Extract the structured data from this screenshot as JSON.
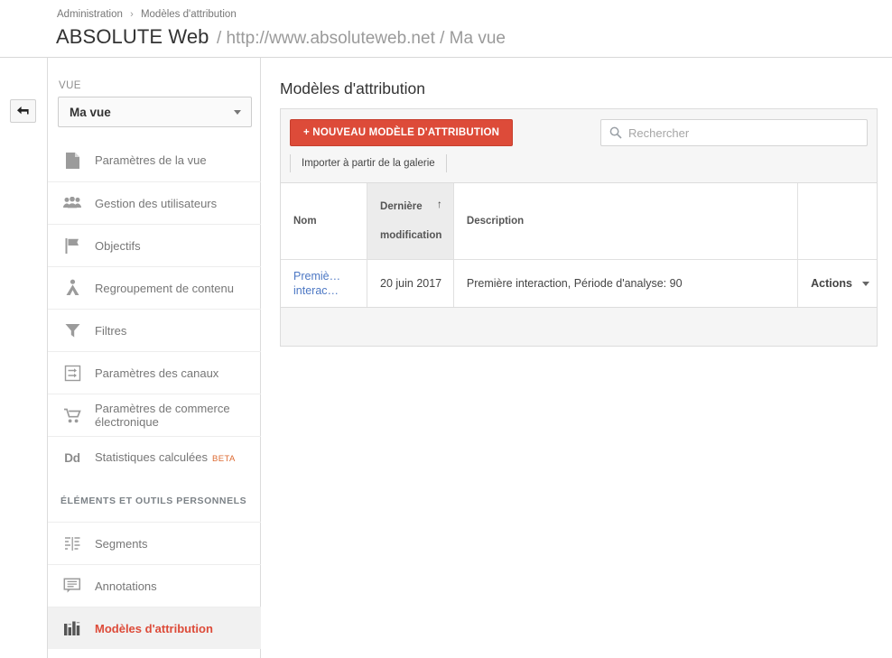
{
  "header": {
    "breadcrumb": [
      "Administration",
      "Modèles d'attribution"
    ],
    "crumb_separator": "›",
    "account_name": "ABSOLUTE Web",
    "property_and_view": "/ http://www.absoluteweb.net / Ma vue"
  },
  "back_button": {
    "icon": "back-arrow-icon"
  },
  "sidebar": {
    "view_label": "VUE",
    "view_selected": "Ma vue",
    "items": [
      {
        "label": "Paramètres de la vue",
        "icon": "document-icon"
      },
      {
        "label": "Gestion des utilisateurs",
        "icon": "users-icon"
      },
      {
        "label": "Objectifs",
        "icon": "flag-icon"
      },
      {
        "label": "Regroupement de contenu",
        "icon": "content-grouping-icon"
      },
      {
        "label": "Filtres",
        "icon": "funnel-icon"
      },
      {
        "label": "Paramètres des canaux",
        "icon": "channels-icon"
      },
      {
        "label": "Paramètres de commerce électronique",
        "icon": "shopping-cart-icon"
      },
      {
        "label": "Statistiques calculées",
        "icon": "dd-icon",
        "badge": "BETA"
      }
    ],
    "section_title": "ÉLÉMENTS ET OUTILS PERSONNELS",
    "personal_items": [
      {
        "label": "Segments",
        "icon": "segments-icon"
      },
      {
        "label": "Annotations",
        "icon": "annotation-bubble-icon"
      },
      {
        "label": "Modèles d'attribution",
        "icon": "bar-chart-icon",
        "active": true
      }
    ]
  },
  "main": {
    "page_title": "Modèles d'attribution",
    "new_button_label": "+ NOUVEAU MODÈLE D'ATTRIBUTION",
    "search": {
      "placeholder": "Rechercher",
      "value": "",
      "icon": "search-icon"
    },
    "import_link": "Importer à partir de la galerie",
    "table": {
      "headers": [
        "Nom",
        "Dernière modification",
        "Description",
        ""
      ],
      "sorted_column": "Dernière modification",
      "sort_direction": "ascending",
      "sort_arrow": "↑",
      "rows": [
        {
          "nom": "Premiè… interac…",
          "nom_line1": "Premiè…",
          "nom_line2": "interac…",
          "modification": "20 juin 2017",
          "description": "Première interaction, Période d'analyse: 90",
          "actions_label": "Actions"
        }
      ]
    }
  },
  "colors": {
    "accent_red": "#dd4b39",
    "link_blue": "#4d78c4",
    "beta_orange": "#dd6b33",
    "text_gray": "#777777"
  }
}
